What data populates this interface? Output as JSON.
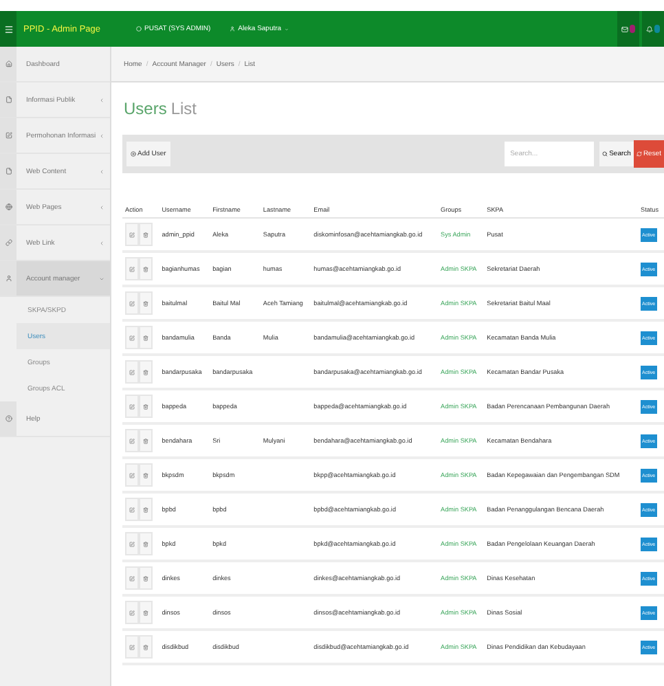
{
  "header": {
    "brand": "PPID - Admin Page",
    "office": "PUSAT (SYS ADMIN)",
    "user": "Aleka Saputra"
  },
  "sidebar": {
    "items": [
      {
        "label": "Dashboard",
        "selected": false
      },
      {
        "label": "Informasi Publik",
        "expanded": false,
        "selected": false
      },
      {
        "label": "Permohonan Informasi",
        "expanded": false,
        "selected": false
      },
      {
        "label": "Web Content",
        "expanded": false,
        "selected": false
      },
      {
        "label": "Web Pages",
        "expanded": false,
        "selected": false
      },
      {
        "label": "Web Link",
        "expanded": false,
        "selected": false
      },
      {
        "label": "Account manager",
        "expanded": true,
        "selected": true,
        "children": [
          {
            "label": "SKPA/SKPD",
            "selected": false
          },
          {
            "label": "Users",
            "selected": true
          },
          {
            "label": "Groups",
            "selected": false
          },
          {
            "label": "Groups ACL",
            "selected": false
          }
        ]
      },
      {
        "label": "Help",
        "selected": false
      }
    ]
  },
  "breadcrumb": {
    "separator": "/",
    "items": [
      "Home",
      "Account Manager",
      "Users",
      "List"
    ]
  },
  "title": {
    "main": "Users",
    "sub": "List"
  },
  "toolbar": {
    "add": "Add User",
    "search_placeholder": "Search...",
    "search": "Search",
    "reset": "Reset"
  },
  "table": {
    "columns": [
      "Action",
      "Username",
      "Firstname",
      "Lastname",
      "Email",
      "Groups",
      "SKPA",
      "Status"
    ],
    "rows": [
      {
        "username": "admin_ppid",
        "firstname": "Aleka",
        "lastname": "Saputra",
        "email": "diskominfosan@acehtamiangkab.go.id",
        "group": "Sys Admin",
        "skpa": "Pusat",
        "status": "Active"
      },
      {
        "username": "bagianhumas",
        "firstname": "bagian",
        "lastname": "humas",
        "email": "humas@acehtamiangkab.go.id",
        "group": "Admin SKPA",
        "skpa": "Sekretariat Daerah",
        "status": "Active"
      },
      {
        "username": "baitulmal",
        "firstname": "Baitul Mal",
        "lastname": "Aceh Tamiang",
        "email": "baitulmal@acehtamiangkab.go.id",
        "group": "Admin SKPA",
        "skpa": "Sekretariat Baitul Maal",
        "status": "Active"
      },
      {
        "username": "bandamulia",
        "firstname": "Banda",
        "lastname": "Mulia",
        "email": "bandamulia@acehtamiangkab.go.id",
        "group": "Admin SKPA",
        "skpa": "Kecamatan Banda Mulia",
        "status": "Active"
      },
      {
        "username": "bandarpusaka",
        "firstname": "bandarpusaka",
        "email": "bandarpusaka@acehtamiangkab.go.id",
        "group": "Admin SKPA",
        "skpa": "Kecamatan Bandar Pusaka",
        "status": "Active"
      },
      {
        "username": "bappeda",
        "firstname": "bappeda",
        "email": "bappeda@acehtamiangkab.go.id",
        "group": "Admin SKPA",
        "skpa": "Badan Perencanaan Pembangunan Daerah",
        "status": "Active"
      },
      {
        "username": "bendahara",
        "firstname": "Sri",
        "lastname": "Mulyani",
        "email": "bendahara@acehtamiangkab.go.id",
        "group": "Admin SKPA",
        "skpa": "Kecamatan Bendahara",
        "status": "Active"
      },
      {
        "username": "bkpsdm",
        "firstname": "bkpsdm",
        "email": "bkpp@acehtamiangkab.go.id",
        "group": "Admin SKPA",
        "skpa": "Badan Kepegawaian dan Pengembangan SDM",
        "status": "Active"
      },
      {
        "username": "bpbd",
        "firstname": "bpbd",
        "email": "bpbd@acehtamiangkab.go.id",
        "group": "Admin SKPA",
        "skpa": "Badan Penanggulangan Bencana Daerah",
        "status": "Active"
      },
      {
        "username": "bpkd",
        "firstname": "bpkd",
        "email": "bpkd@acehtamiangkab.go.id",
        "group": "Admin SKPA",
        "skpa": "Badan Pengelolaan Keuangan Daerah",
        "status": "Active"
      },
      {
        "username": "dinkes",
        "firstname": "dinkes",
        "email": "dinkes@acehtamiangkab.go.id",
        "group": "Admin SKPA",
        "skpa": "Dinas Kesehatan",
        "status": "Active"
      },
      {
        "username": "dinsos",
        "firstname": "dinsos",
        "email": "dinsos@acehtamiangkab.go.id",
        "group": "Admin SKPA",
        "skpa": "Dinas Sosial",
        "status": "Active"
      },
      {
        "username": "disdikbud",
        "firstname": "disdikbud",
        "email": "disdikbud@acehtamiangkab.go.id",
        "group": "Admin SKPA",
        "skpa": "Dinas Pendidikan dan Kebudayaan",
        "status": "Active"
      }
    ]
  }
}
